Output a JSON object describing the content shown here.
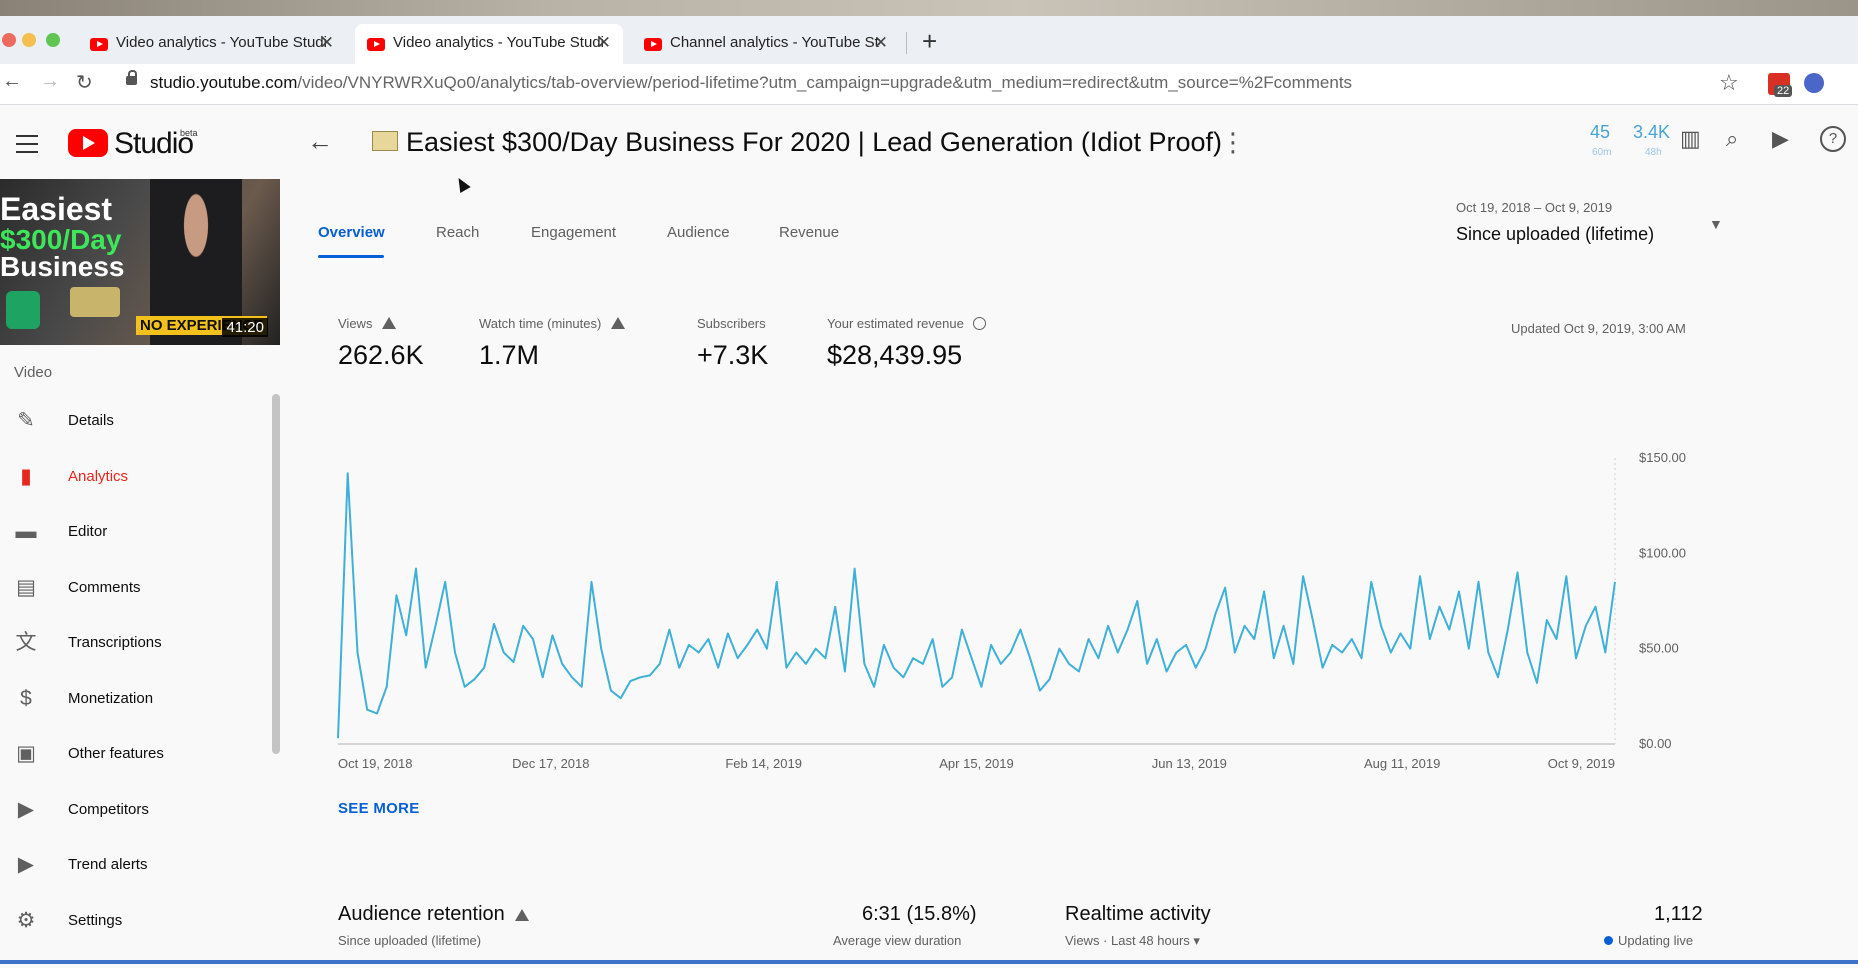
{
  "browser": {
    "tabs": [
      {
        "title": "Video analytics - YouTube Studio",
        "active": false
      },
      {
        "title": "Video analytics - YouTube Studio",
        "active": true
      },
      {
        "title": "Channel analytics - YouTube Studio",
        "active": false
      }
    ],
    "url_host": "studio.youtube.com",
    "url_path": "/video/VNYRWRXuQo0/analytics/tab-overview/period-lifetime?utm_campaign=upgrade&utm_medium=redirect&utm_source=%2Fcomments",
    "extension_badge": "22"
  },
  "header": {
    "logo_text": "Studio",
    "beta_label": "beta",
    "video_title": "Easiest $300/Day Business For 2020 | Lead Generation (Idiot Proof)",
    "realtime": [
      {
        "value": "45",
        "label": "60m"
      },
      {
        "value": "3.4K",
        "label": "48h"
      }
    ]
  },
  "sidebar": {
    "thumbnail": {
      "line1": "Easiest",
      "line2": "$300/Day",
      "line3": "Business",
      "badge": "NO EXPERIENCE",
      "duration": "41:20"
    },
    "section_label": "Video",
    "items": [
      {
        "label": "Details",
        "icon": "pencil-icon",
        "glyph": "✎",
        "active": false
      },
      {
        "label": "Analytics",
        "icon": "analytics-icon",
        "glyph": "▮",
        "active": true
      },
      {
        "label": "Editor",
        "icon": "film-icon",
        "glyph": "▬",
        "active": false
      },
      {
        "label": "Comments",
        "icon": "comment-icon",
        "glyph": "▤",
        "active": false
      },
      {
        "label": "Transcriptions",
        "icon": "translate-icon",
        "glyph": "文",
        "active": false
      },
      {
        "label": "Monetization",
        "icon": "dollar-icon",
        "glyph": "$",
        "active": false
      },
      {
        "label": "Other features",
        "icon": "other-features-icon",
        "glyph": "▣",
        "active": false
      },
      {
        "label": "Competitors",
        "icon": "competitors-icon",
        "glyph": "▶",
        "active": false
      },
      {
        "label": "Trend alerts",
        "icon": "trend-alerts-icon",
        "glyph": "▶",
        "active": false
      },
      {
        "label": "Settings",
        "icon": "gear-icon",
        "glyph": "⚙",
        "active": false
      }
    ]
  },
  "main": {
    "tabs": [
      "Overview",
      "Reach",
      "Engagement",
      "Audience",
      "Revenue"
    ],
    "date_range": "Oct 19, 2018 – Oct 9, 2019",
    "period": "Since uploaded (lifetime)",
    "metrics": [
      {
        "label": "Views",
        "value": "262.6K",
        "icon": "warning-icon"
      },
      {
        "label": "Watch time (minutes)",
        "value": "1.7M",
        "icon": "warning-icon"
      },
      {
        "label": "Subscribers",
        "value": "+7.3K",
        "icon": ""
      },
      {
        "label": "Your estimated revenue",
        "value": "$28,439.95",
        "icon": "clock-icon"
      }
    ],
    "updated": "Updated Oct 9, 2019, 3:00 AM",
    "see_more": "SEE MORE",
    "cards": {
      "retention_title": "Audience retention",
      "retention_sub": "Since uploaded (lifetime)",
      "retention_value": "6:31 (15.8%)",
      "retention_value_sub": "Average view duration",
      "realtime_title": "Realtime activity",
      "realtime_sub": "Views · Last 48 hours",
      "realtime_value": "1,112",
      "realtime_value_sub": "Updating live"
    }
  },
  "colors": {
    "accent": "#065fd4",
    "active_nav": "#e5271f",
    "line": "#3fb0d8",
    "youtube_red": "#ff0000"
  },
  "chart_data": {
    "type": "line",
    "x_tick_labels": [
      "Oct 19, 2018",
      "Dec 17, 2018",
      "Feb 14, 2019",
      "Apr 15, 2019",
      "Jun 13, 2019",
      "Aug 11, 2019",
      "Oct 9, 2019"
    ],
    "y_tick_labels": [
      "$150.00",
      "$100.00",
      "$50.00",
      "$0.00"
    ],
    "ylim": [
      0,
      150
    ],
    "x": [
      "2018-10-19",
      "2018-10-25",
      "2018-11-05",
      "2018-11-15",
      "2018-11-25",
      "2018-12-05",
      "2018-12-15",
      "2018-12-25",
      "2019-01-05",
      "2019-01-15",
      "2019-01-25",
      "2019-02-05",
      "2019-02-15",
      "2019-02-25",
      "2019-03-05",
      "2019-03-15",
      "2019-03-25",
      "2019-04-05",
      "2019-04-15",
      "2019-04-25",
      "2019-05-05",
      "2019-05-15",
      "2019-05-25",
      "2019-06-05",
      "2019-06-15",
      "2019-06-25",
      "2019-07-05",
      "2019-07-15",
      "2019-07-25",
      "2019-08-05",
      "2019-08-15",
      "2019-08-25",
      "2019-09-05",
      "2019-09-15",
      "2019-09-25",
      "2019-10-05",
      "2019-10-09"
    ],
    "series": [
      {
        "values": [
          3,
          142,
          48,
          18,
          16,
          30,
          78,
          57,
          92,
          40,
          62,
          85,
          48,
          30,
          34,
          40,
          63,
          48,
          43,
          62,
          55,
          35,
          57,
          42,
          35,
          30,
          85,
          50,
          28,
          24,
          33,
          35,
          36,
          42,
          60,
          40,
          52,
          48,
          55,
          40,
          58,
          45,
          52,
          60,
          50,
          85,
          40,
          48,
          42,
          50,
          45,
          72,
          38,
          92,
          42,
          30,
          52,
          40,
          35,
          45,
          42,
          55,
          30,
          35,
          60,
          45,
          30,
          52,
          42,
          48,
          60,
          45,
          28,
          34,
          50,
          42,
          38,
          55,
          45,
          62,
          48,
          60,
          75,
          42,
          55,
          38,
          48,
          52,
          40,
          50,
          68,
          82,
          48,
          62,
          55,
          80,
          45,
          62,
          42,
          88,
          65,
          40,
          52,
          48,
          55,
          45,
          85,
          62,
          48,
          58,
          50,
          88,
          55,
          72,
          60,
          80,
          50,
          85,
          48,
          35,
          60,
          90,
          48,
          32,
          65,
          55,
          88,
          45,
          62,
          72,
          48,
          85
        ]
      }
    ]
  }
}
